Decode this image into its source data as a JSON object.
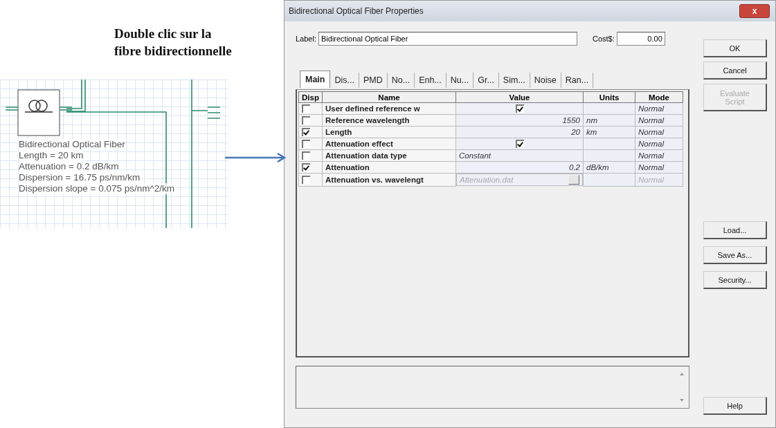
{
  "caption": {
    "lines": [
      "Double clic sur la",
      "fibre bidirectionnelle"
    ]
  },
  "schematic": {
    "component_lines": [
      "Bidirectional Optical Fiber",
      "Length = 20  km",
      "Attenuation = 0.2  dB/km",
      "Dispersion = 16.75  ps/nm/km",
      "Dispersion slope = 0.075  ps/nm^2/km"
    ]
  },
  "window": {
    "title": "Bidirectional Optical Fiber Properties",
    "close": "x"
  },
  "label_field": {
    "label": "Label:",
    "value": "Bidirectional Optical Fiber"
  },
  "cost_field": {
    "label": "Cost$:",
    "value": "0.00"
  },
  "tabs": [
    {
      "label": "Main",
      "selected": true
    },
    {
      "label": "Dis...",
      "selected": false
    },
    {
      "label": "PMD",
      "selected": false
    },
    {
      "label": "No...",
      "selected": false
    },
    {
      "label": "Enh...",
      "selected": false
    },
    {
      "label": "Nu...",
      "selected": false
    },
    {
      "label": "Gr...",
      "selected": false
    },
    {
      "label": "Sim...",
      "selected": false
    },
    {
      "label": "Noise",
      "selected": false
    },
    {
      "label": "Ran...",
      "selected": false
    }
  ],
  "table": {
    "columns": [
      "Disp",
      "Name",
      "Value",
      "Units",
      "Mode"
    ],
    "rows": [
      {
        "disp": false,
        "name": "User defined reference w",
        "kind": "check",
        "checked": true,
        "units": "",
        "mode": "Normal",
        "disabled": false
      },
      {
        "disp": false,
        "name": "Reference wavelength",
        "kind": "number",
        "value": "1550",
        "units": "nm",
        "mode": "Normal",
        "disabled": false
      },
      {
        "disp": true,
        "name": "Length",
        "kind": "number",
        "value": "20",
        "units": "km",
        "mode": "Normal",
        "disabled": false
      },
      {
        "disp": false,
        "name": "Attenuation effect",
        "kind": "check",
        "checked": true,
        "units": "",
        "mode": "Normal",
        "disabled": false
      },
      {
        "disp": false,
        "name": "Attenuation data type",
        "kind": "text",
        "value": "Constant",
        "units": "",
        "mode": "Normal",
        "disabled": false
      },
      {
        "disp": true,
        "name": "Attenuation",
        "kind": "number",
        "value": "0.2",
        "units": "dB/km",
        "mode": "Normal",
        "disabled": false
      },
      {
        "disp": false,
        "name": "Attenuation vs. wavelengt",
        "kind": "file",
        "value": "Attenuation.dat",
        "units": "",
        "mode": "Normal",
        "disabled": true
      }
    ]
  },
  "buttons_top": [
    {
      "label": "OK",
      "disabled": false
    },
    {
      "label": "Cancel",
      "disabled": false
    },
    {
      "label": "Evaluate Script",
      "disabled": true
    }
  ],
  "buttons_middle": [
    {
      "label": "Load...",
      "disabled": false
    },
    {
      "label": "Save As...",
      "disabled": false
    },
    {
      "label": "Security...",
      "disabled": false
    }
  ],
  "buttons_bottom": [
    {
      "label": "Help",
      "disabled": false
    }
  ]
}
